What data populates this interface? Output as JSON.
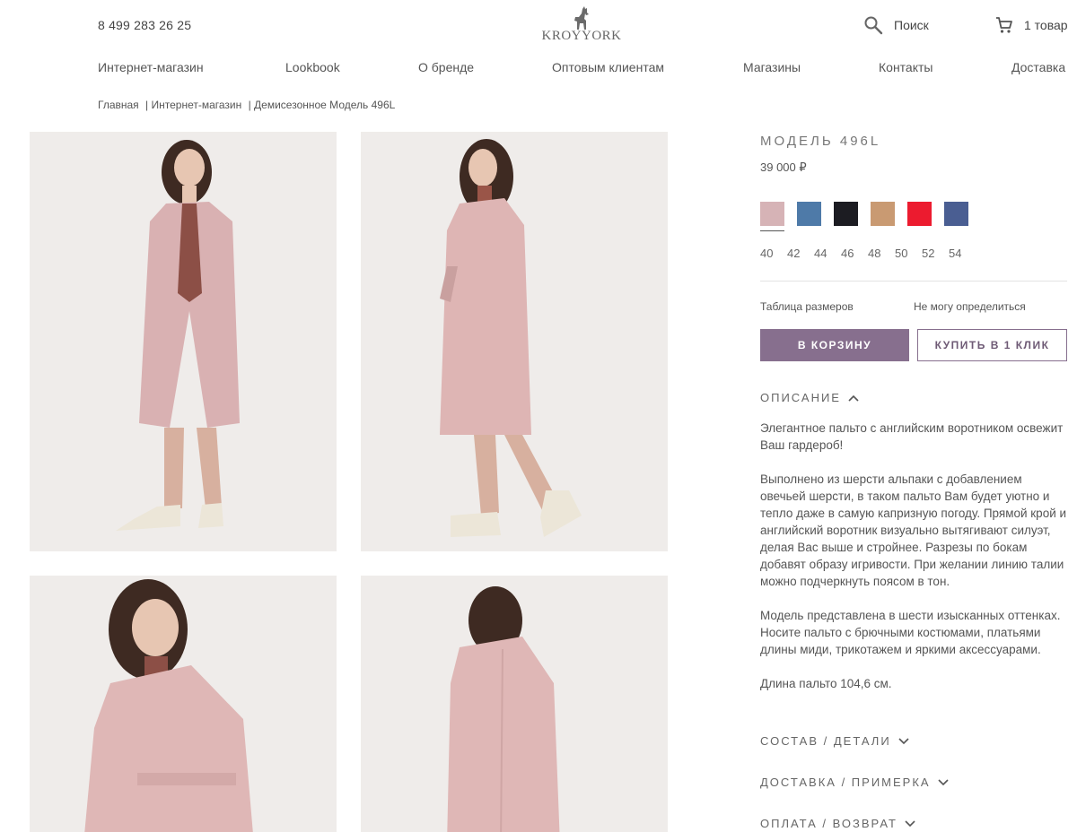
{
  "header": {
    "phone": "8 499 283 26 25",
    "logo_text": "KROYYORK",
    "search_label": "Поиск",
    "cart_label": "1 товар"
  },
  "nav": [
    "Интернет-магазин",
    "Lookbook",
    "О бренде",
    "Оптовым клиентам",
    "Магазины",
    "Контакты",
    "Доставка"
  ],
  "breadcrumbs": [
    "Главная",
    "| Интернет-магазин",
    "| Демисезонное Модель 496L"
  ],
  "product": {
    "title": "МОДЕЛЬ 496L",
    "price": "39 000 ₽",
    "colors": [
      "#d6b3b6",
      "#4e7aa8",
      "#1c1c22",
      "#c99a72",
      "#ec1b2f",
      "#4a5e92"
    ],
    "sizes": [
      "40",
      "42",
      "44",
      "46",
      "48",
      "50",
      "52",
      "54"
    ],
    "size_table": "Таблица размеров",
    "not_sure": "Не могу определиться",
    "add_to_cart": "В КОРЗИНУ",
    "buy_one_click": "КУПИТЬ В 1 КЛИК"
  },
  "description": {
    "heading": "ОПИСАНИЕ",
    "paragraphs": [
      "Элегантное пальто с английским воротником освежит Ваш гардероб!",
      "Выполнено из шерсти альпаки с добавлением овечьей шерсти, в таком пальто Вам будет уютно и тепло даже в самую капризную погоду. Прямой крой и английский воротник визуально вытягивают силуэт, делая Вас выше и стройнее. Разрезы по бокам добавят образу игривости. При желании линию талии можно подчеркнуть поясом в тон.",
      "Модель представлена в шести изысканных оттенках. Носите пальто с брючными костюмами, платьями длины миди, трикотажем и яркими аксессуарами.",
      "Длина пальто 104,6 см."
    ]
  },
  "accordions": [
    "СОСТАВ / ДЕТАЛИ",
    "ДОСТАВКА / ПРИМЕРКА",
    "ОПЛАТА / ВОЗВРАТ"
  ]
}
